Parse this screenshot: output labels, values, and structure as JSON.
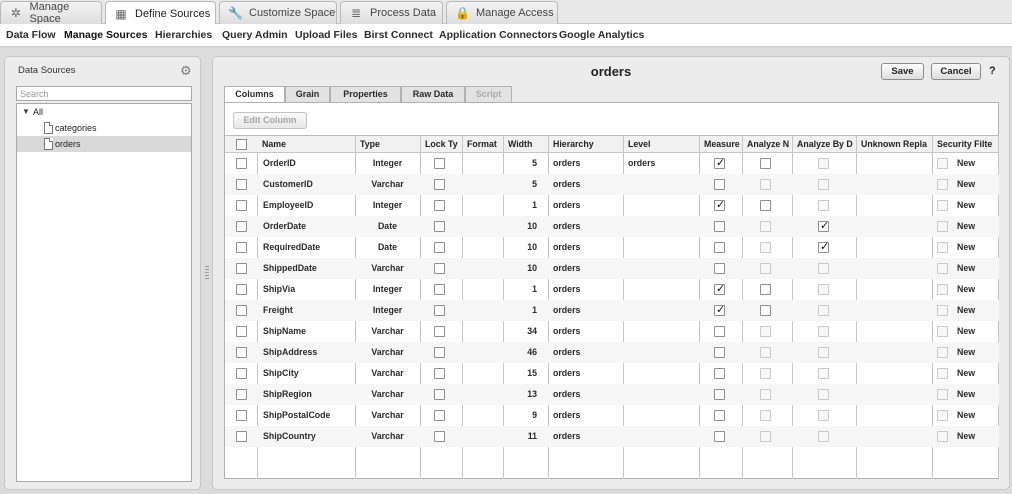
{
  "top_tabs": [
    {
      "label": "Manage Space",
      "icon": "manage-space-icon",
      "glyph": "✲"
    },
    {
      "label": "Define Sources",
      "icon": "define-sources-icon",
      "glyph": "▦",
      "active": true
    },
    {
      "label": "Customize Space",
      "icon": "wrench-icon",
      "glyph": "🔧"
    },
    {
      "label": "Process Data",
      "icon": "database-icon",
      "glyph": "≣"
    },
    {
      "label": "Manage Access",
      "icon": "lock-icon",
      "glyph": "🔒"
    }
  ],
  "subnav": [
    "Data Flow",
    "Manage Sources",
    "Hierarchies",
    "Query Admin",
    "Upload Files",
    "Birst Connect",
    "Application Connectors",
    "Google Analytics"
  ],
  "left_panel": {
    "title": "Data Sources",
    "search_placeholder": "Search",
    "tree": {
      "root": "All",
      "children": [
        "categories",
        "orders"
      ],
      "selected": "orders"
    }
  },
  "main": {
    "title": "orders",
    "save_label": "Save",
    "cancel_label": "Cancel",
    "help_label": "?",
    "tabs": [
      {
        "label": "Columns",
        "active": true
      },
      {
        "label": "Grain"
      },
      {
        "label": "Properties"
      },
      {
        "label": "Raw Data"
      },
      {
        "label": "Script",
        "disabled": true
      }
    ],
    "edit_column_label": "Edit Column"
  },
  "grid": {
    "headers": [
      "Name",
      "Type",
      "Lock Ty",
      "Format",
      "Width",
      "Hierarchy",
      "Level",
      "Measure",
      "Analyze N",
      "Analyze By D",
      "Unknown Repla",
      "Security Filte"
    ],
    "rows": [
      {
        "name": "OrderID",
        "type": "Integer",
        "width": "5",
        "hierarchy": "orders",
        "level": "orders",
        "measure": true,
        "analyze_by_date": false,
        "new": "New"
      },
      {
        "name": "CustomerID",
        "type": "Varchar",
        "width": "5",
        "hierarchy": "orders",
        "level": "",
        "measure": false,
        "analyze_by_date": false,
        "new": "New"
      },
      {
        "name": "EmployeeID",
        "type": "Integer",
        "width": "1",
        "hierarchy": "orders",
        "level": "",
        "measure": true,
        "analyze_by_date": false,
        "new": "New"
      },
      {
        "name": "OrderDate",
        "type": "Date",
        "width": "10",
        "hierarchy": "orders",
        "level": "",
        "measure": false,
        "analyze_by_date": true,
        "new": "New"
      },
      {
        "name": "RequiredDate",
        "type": "Date",
        "width": "10",
        "hierarchy": "orders",
        "level": "",
        "measure": false,
        "analyze_by_date": true,
        "new": "New"
      },
      {
        "name": "ShippedDate",
        "type": "Varchar",
        "width": "10",
        "hierarchy": "orders",
        "level": "",
        "measure": false,
        "analyze_by_date": false,
        "new": "New"
      },
      {
        "name": "ShipVia",
        "type": "Integer",
        "width": "1",
        "hierarchy": "orders",
        "level": "",
        "measure": true,
        "analyze_by_date": false,
        "new": "New"
      },
      {
        "name": "Freight",
        "type": "Integer",
        "width": "1",
        "hierarchy": "orders",
        "level": "",
        "measure": true,
        "analyze_by_date": false,
        "new": "New"
      },
      {
        "name": "ShipName",
        "type": "Varchar",
        "width": "34",
        "hierarchy": "orders",
        "level": "",
        "measure": false,
        "analyze_by_date": false,
        "new": "New"
      },
      {
        "name": "ShipAddress",
        "type": "Varchar",
        "width": "46",
        "hierarchy": "orders",
        "level": "",
        "measure": false,
        "analyze_by_date": false,
        "new": "New"
      },
      {
        "name": "ShipCity",
        "type": "Varchar",
        "width": "15",
        "hierarchy": "orders",
        "level": "",
        "measure": false,
        "analyze_by_date": false,
        "new": "New"
      },
      {
        "name": "ShipRegion",
        "type": "Varchar",
        "width": "13",
        "hierarchy": "orders",
        "level": "",
        "measure": false,
        "analyze_by_date": false,
        "new": "New"
      },
      {
        "name": "ShipPostalCode",
        "type": "Varchar",
        "width": "9",
        "hierarchy": "orders",
        "level": "",
        "measure": false,
        "analyze_by_date": false,
        "new": "New"
      },
      {
        "name": "ShipCountry",
        "type": "Varchar",
        "width": "11",
        "hierarchy": "orders",
        "level": "",
        "measure": false,
        "analyze_by_date": false,
        "new": "New"
      }
    ]
  }
}
